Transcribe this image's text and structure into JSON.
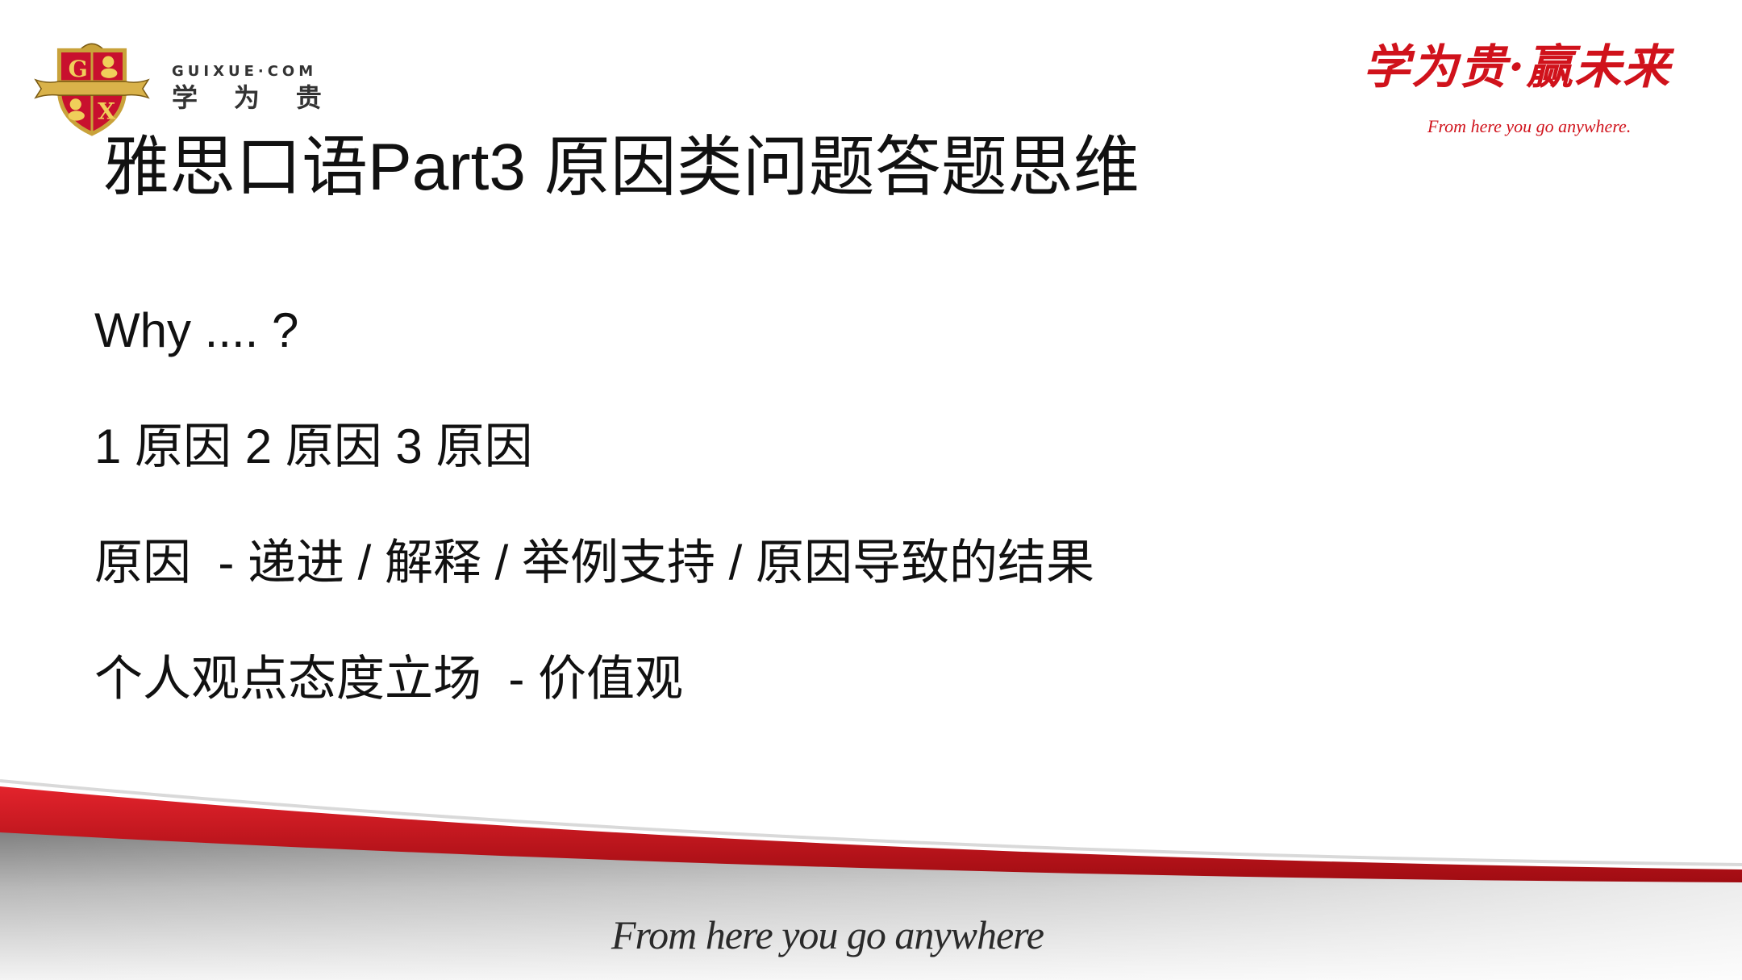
{
  "logo": {
    "shield_letters": [
      "G",
      "X"
    ],
    "site": "GUIXUE·COM",
    "name": "学 为 贵"
  },
  "slogan": {
    "main": "学为贵·赢未来",
    "sub": "From here you go anywhere."
  },
  "title": "雅思口语Part3 原因类问题答题思维",
  "lines": [
    "Why .... ?",
    "1 原因 2 原因 3 原因",
    "原因  - 递进 / 解释 / 举例支持 / 原因导致的结果",
    "个人观点态度立场  - 价值观"
  ],
  "footer": {
    "tagline": "From here you go anywhere"
  },
  "colors": {
    "brand_red": "#d0121b",
    "gold": "#c9a23a",
    "text": "#111111"
  }
}
